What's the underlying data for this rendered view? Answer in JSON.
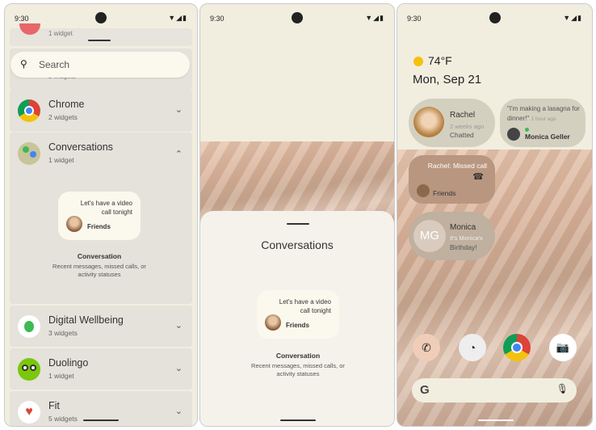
{
  "status": {
    "time": "9:30",
    "icons": "▼◢▮"
  },
  "panel1": {
    "partial_top": "1 widget",
    "search_placeholder": "Search",
    "partial_row": "2 widgets",
    "apps": [
      {
        "name": "Chrome",
        "count": "2 widgets",
        "chevron": "⌄"
      },
      {
        "name": "Conversations",
        "count": "1 widget",
        "chevron": "⌃"
      },
      {
        "name": "Digital Wellbeing",
        "count": "3 widgets",
        "chevron": "⌄"
      },
      {
        "name": "Duolingo",
        "count": "1 widget",
        "chevron": "⌄"
      },
      {
        "name": "Fit",
        "count": "5 widgets",
        "chevron": "⌄"
      }
    ],
    "preview": {
      "message": "Let's have a video call tonight",
      "group": "Friends",
      "title": "Conversation",
      "description": "Recent messages, missed calls, or activity statuses"
    }
  },
  "panel2": {
    "sheet_title": "Conversations",
    "preview": {
      "message": "Let's have a video call tonight",
      "group": "Friends",
      "title": "Conversation",
      "description": "Recent messages, missed calls, or activity statuses"
    }
  },
  "panel3": {
    "weather": "74°F",
    "date": "Mon, Sep 21",
    "rachel": {
      "name": "Rachel",
      "time": "2 weeks ago",
      "status": "Chatted"
    },
    "quote": {
      "text": "\"I'm making a lasagna for dinner!\"",
      "time": "1 hour ago",
      "name": "Monica Geller"
    },
    "missed": {
      "text": "Rachel: Missed call",
      "group": "Friends"
    },
    "monica": {
      "initials": "MG",
      "name": "Monica",
      "line1": "It's Monica's",
      "line2": "Birthday!"
    },
    "search_logo": "G",
    "mic": "🎙"
  },
  "colors": {
    "accent_green": "#3cba54",
    "chrome_red": "#db4437",
    "chrome_yellow": "#f4c20d",
    "chrome_blue": "#4285f4"
  }
}
